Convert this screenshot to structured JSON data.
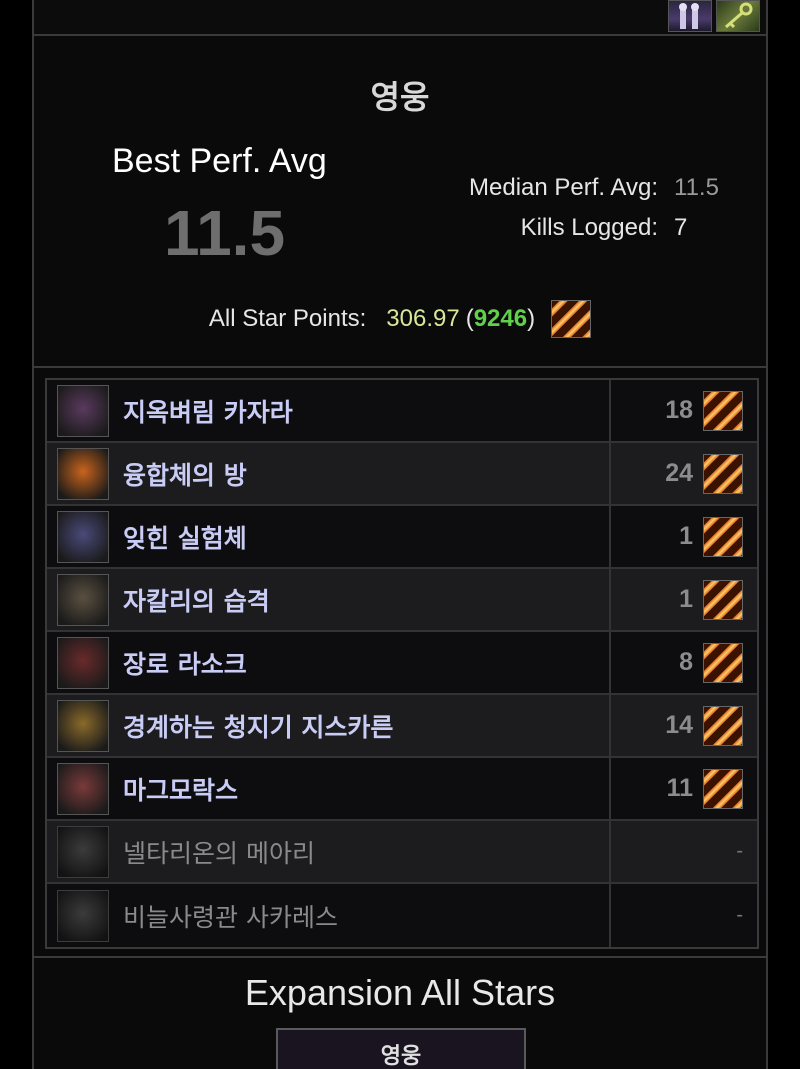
{
  "top_strip": {
    "icons": [
      "armor-set-icon",
      "key-icon"
    ]
  },
  "summary": {
    "difficulty": "영웅",
    "best_perf_label": "Best Perf. Avg",
    "best_perf_value": "11.5",
    "median_label": "Median Perf. Avg:",
    "median_value": "11.5",
    "kills_label": "Kills Logged:",
    "kills_value": "7",
    "allstar_label": "All Star Points:",
    "allstar_points": "306.97",
    "allstar_open": "(",
    "allstar_rank": "9246",
    "allstar_close": ")"
  },
  "bosses": [
    {
      "name": "지옥벼림 카자라",
      "score": "18",
      "active": true,
      "icon": "boss-kazzara-icon",
      "color": "#5a3a5e"
    },
    {
      "name": "융합체의 방",
      "score": "24",
      "active": true,
      "icon": "boss-chamber-icon",
      "color": "#c9641c"
    },
    {
      "name": "잊힌 실험체",
      "score": "1",
      "active": true,
      "icon": "boss-experiments-icon",
      "color": "#4a4a7a"
    },
    {
      "name": "자칼리의 습격",
      "score": "1",
      "active": true,
      "icon": "boss-zaqali-icon",
      "color": "#5a5040"
    },
    {
      "name": "장로 라소크",
      "score": "8",
      "active": true,
      "icon": "boss-rashok-icon",
      "color": "#6a2a2a"
    },
    {
      "name": "경계하는 청지기 지스카른",
      "score": "14",
      "active": true,
      "icon": "boss-zskarn-icon",
      "color": "#8a6a2a"
    },
    {
      "name": "마그모락스",
      "score": "11",
      "active": true,
      "icon": "boss-magmorax-icon",
      "color": "#7a3a3a"
    },
    {
      "name": "넬타리온의 메아리",
      "score": "-",
      "active": false,
      "icon": "boss-neltharion-icon",
      "color": "#555555"
    },
    {
      "name": "비늘사령관 사카레스",
      "score": "-",
      "active": false,
      "icon": "boss-sarkareth-icon",
      "color": "#555555"
    }
  ],
  "footer": {
    "title": "Expansion All Stars",
    "difficulty_select": "영웅"
  }
}
